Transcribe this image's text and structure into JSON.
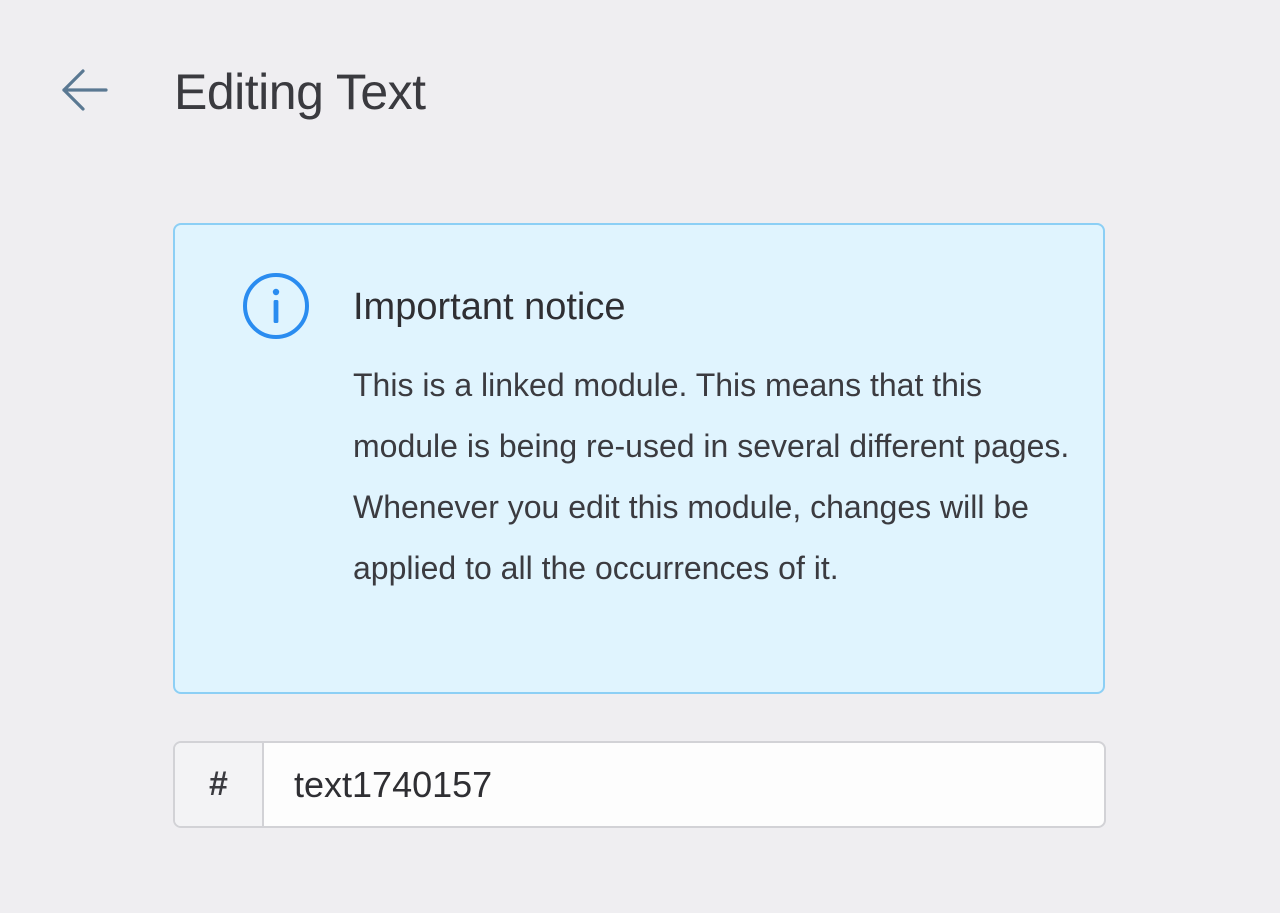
{
  "header": {
    "back_icon": "arrow-left-icon",
    "title": "Editing Text"
  },
  "notice": {
    "icon": "info-icon",
    "title": "Important notice",
    "body": "This is a linked module. This means that this module is being re-used in several different pages. Whenever you edit this module, changes will be applied to all the occurrences of it."
  },
  "id_field": {
    "prefix": "#",
    "value": "text1740157"
  },
  "colors": {
    "background": "#efeef1",
    "notice_background": "#e0f4fe",
    "notice_border": "#8ccff5",
    "info_icon": "#2a8cf0",
    "back_arrow": "#5a7892"
  }
}
